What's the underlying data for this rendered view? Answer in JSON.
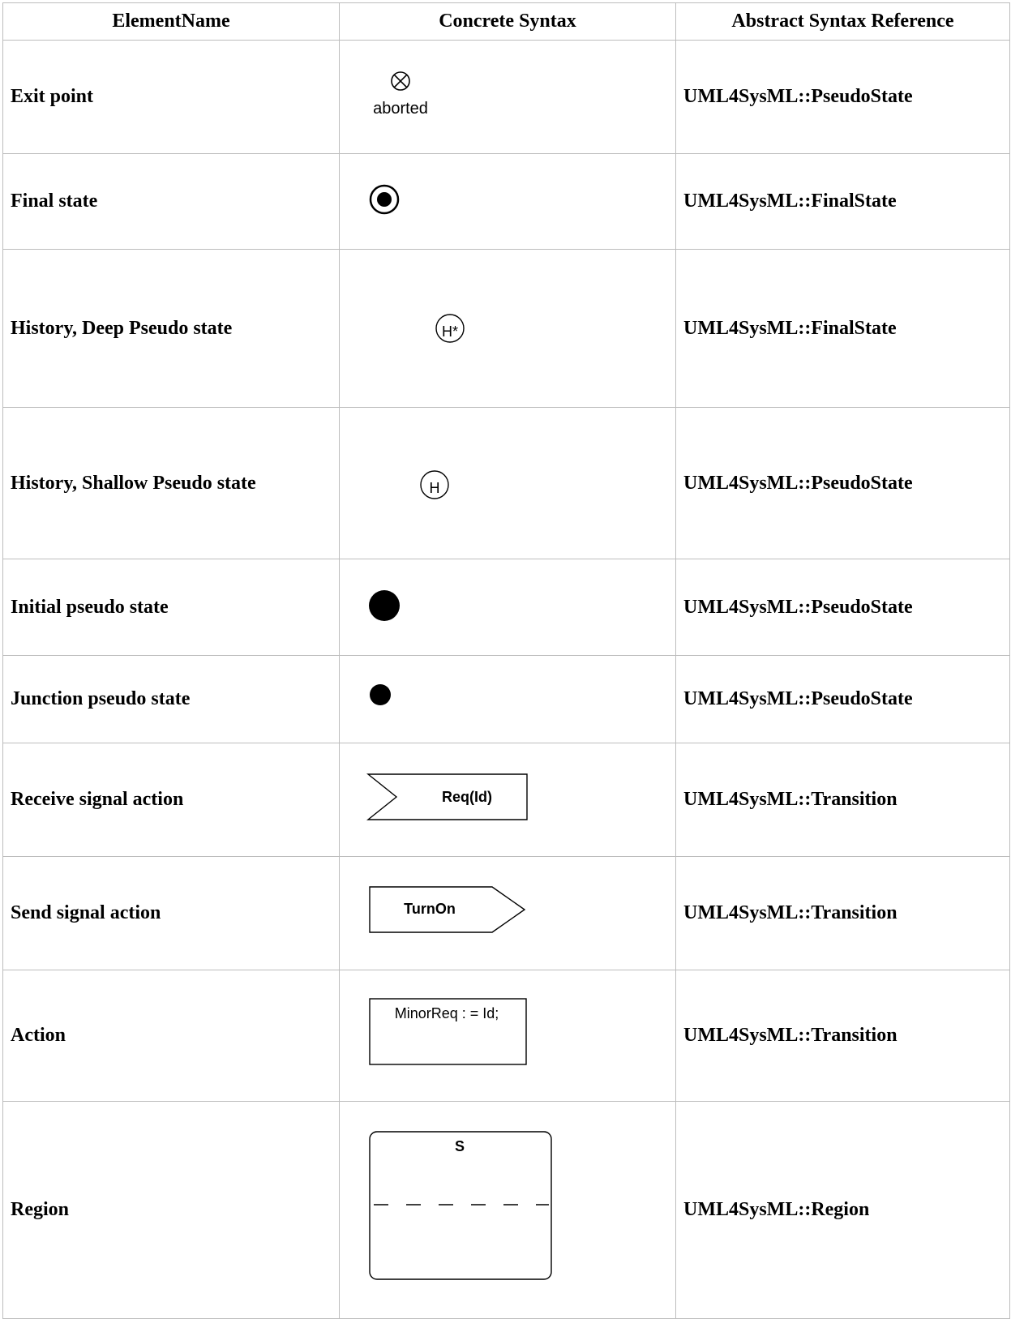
{
  "headers": {
    "element_name": "ElementName",
    "concrete_syntax": "Concrete Syntax",
    "abstract_ref": "Abstract Syntax Reference"
  },
  "rows": [
    {
      "name": "Exit point",
      "ref": "UML4SysML::PseudoState",
      "symbol": "exit-point-icon",
      "label": "aborted"
    },
    {
      "name": "Final state",
      "ref": "UML4SysML::FinalState",
      "symbol": "final-state-icon"
    },
    {
      "name": "History, Deep Pseudo state",
      "ref": "UML4SysML::FinalState",
      "symbol": "deep-history-icon",
      "label": "H*"
    },
    {
      "name": "History, Shallow Pseudo state",
      "ref": "UML4SysML::PseudoState",
      "symbol": "shallow-history-icon",
      "label": "H"
    },
    {
      "name": "Initial pseudo state",
      "ref": "UML4SysML::PseudoState",
      "symbol": "initial-state-icon"
    },
    {
      "name": "Junction pseudo state",
      "ref": "UML4SysML::PseudoState",
      "symbol": "junction-icon"
    },
    {
      "name": "Receive signal action",
      "ref": "UML4SysML::Transition",
      "symbol": "receive-signal-icon",
      "label": "Req(Id)"
    },
    {
      "name": "Send signal action",
      "ref": "UML4SysML::Transition",
      "symbol": "send-signal-icon",
      "label": "TurnOn"
    },
    {
      "name": "Action",
      "ref": "UML4SysML::Transition",
      "symbol": "action-box-icon",
      "label": "MinorReq : = Id;"
    },
    {
      "name": "Region",
      "ref": "UML4SysML::Region",
      "symbol": "region-icon",
      "label": "S"
    }
  ]
}
